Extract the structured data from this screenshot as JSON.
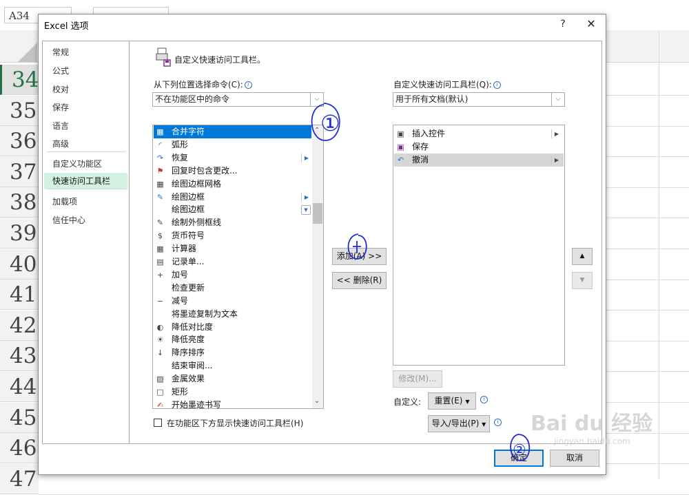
{
  "excel": {
    "name_box": "A34",
    "rows": [
      "34",
      "35",
      "36",
      "37",
      "38",
      "39",
      "40",
      "41",
      "42",
      "43",
      "44",
      "45",
      "46",
      "47"
    ],
    "selected_row": "34"
  },
  "dialog": {
    "title": "Excel 选项",
    "help": "?",
    "close": "✕",
    "nav": [
      {
        "label": "常规"
      },
      {
        "label": "公式"
      },
      {
        "label": "校对"
      },
      {
        "label": "保存"
      },
      {
        "label": "语言"
      },
      {
        "label": "高级"
      },
      {
        "label": "自定义功能区"
      },
      {
        "label": "快速访问工具栏",
        "active": true
      },
      {
        "label": "加载项"
      },
      {
        "label": "信任中心"
      }
    ],
    "header": {
      "text": "自定义快速访问工具栏。",
      "icon": "quick-access-toolbar-icon"
    },
    "left": {
      "label": "从下列位置选择命令(C):",
      "combo_value": "不在功能区中的命令",
      "commands": [
        {
          "label": "合并字符",
          "icon": "merge-chars-icon",
          "selected": true,
          "submenu": false
        },
        {
          "label": "弧形",
          "icon": "arc-icon",
          "submenu": false
        },
        {
          "label": "恢复",
          "icon": "redo-icon",
          "submenu": true
        },
        {
          "label": "回复时包含更改...",
          "icon": "reply-flag-icon",
          "submenu": false
        },
        {
          "label": "绘图边框网格",
          "icon": "draw-border-grid-icon",
          "submenu": false
        },
        {
          "label": "绘图边框",
          "icon": "draw-border-icon",
          "submenu": true
        },
        {
          "label": "绘图边框",
          "icon": "",
          "submenu": false,
          "dropdown": true
        },
        {
          "label": "绘制外侧框线",
          "icon": "outside-border-icon",
          "submenu": false
        },
        {
          "label": "货币符号",
          "icon": "currency-icon",
          "submenu": false
        },
        {
          "label": "计算器",
          "icon": "calculator-icon",
          "submenu": false
        },
        {
          "label": "记录单...",
          "icon": "form-icon",
          "submenu": false
        },
        {
          "label": "加号",
          "icon": "plus-sign-icon",
          "submenu": false
        },
        {
          "label": "检查更新",
          "icon": "",
          "submenu": false
        },
        {
          "label": "减号",
          "icon": "minus-sign-icon",
          "submenu": false
        },
        {
          "label": "将墨迹复制为文本",
          "icon": "",
          "submenu": false
        },
        {
          "label": "降低对比度",
          "icon": "decrease-contrast-icon",
          "submenu": false
        },
        {
          "label": "降低亮度",
          "icon": "decrease-brightness-icon",
          "submenu": false
        },
        {
          "label": "降序排序",
          "icon": "sort-descending-icon",
          "submenu": false
        },
        {
          "label": "结束审阅...",
          "icon": "",
          "submenu": false
        },
        {
          "label": "金属效果",
          "icon": "metal-effect-icon",
          "submenu": false
        },
        {
          "label": "矩形",
          "icon": "rectangle-icon",
          "submenu": false
        },
        {
          "label": "开始墨迹书写",
          "icon": "ink-icon",
          "submenu": false
        }
      ],
      "checkbox_label": "在功能区下方显示快速访问工具栏(H)"
    },
    "middle": {
      "add": "添加(A) >>",
      "remove": "<< 删除(R)"
    },
    "right": {
      "label": "自定义快速访问工具栏(Q):",
      "combo_value": "用于所有文档(默认)",
      "items": [
        {
          "label": "插入控件",
          "icon": "insert-control-icon",
          "submenu": true
        },
        {
          "label": "保存",
          "icon": "save-icon",
          "submenu": false
        },
        {
          "label": "撤消",
          "icon": "undo-icon",
          "submenu": true,
          "highlight": true
        }
      ],
      "modify": "修改(M)...",
      "customize_label": "自定义:",
      "reset": "重置(E)",
      "import_export": "导入/导出(P)"
    },
    "footer": {
      "ok": "确定",
      "cancel": "取消"
    },
    "annotations": [
      "①",
      "②"
    ]
  },
  "watermark": "Bai du 经验",
  "watermark_url": "jingyan.baidu.com"
}
